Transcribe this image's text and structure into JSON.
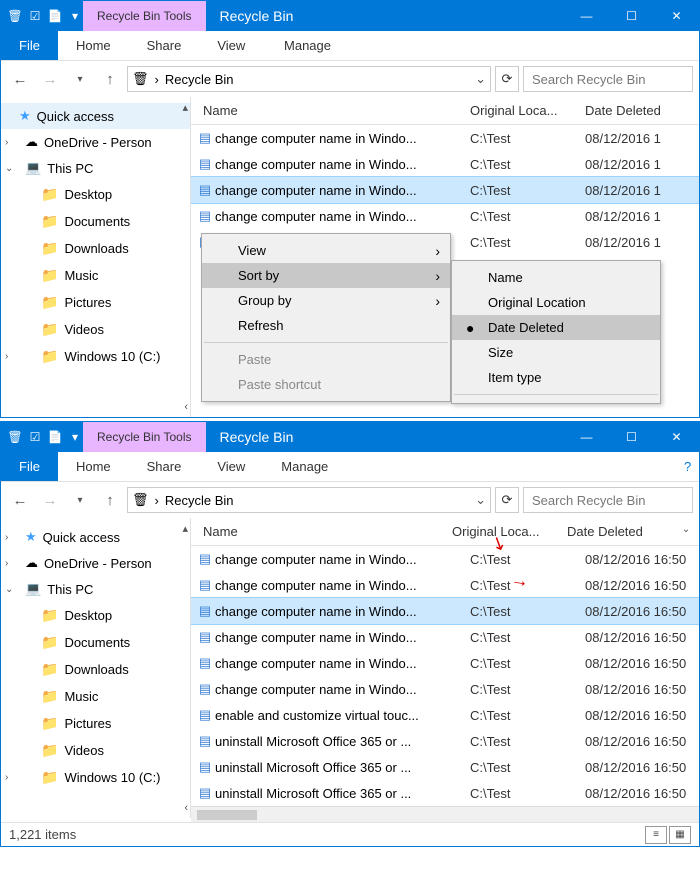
{
  "win1": {
    "tools_tab": "Recycle Bin Tools",
    "title": "Recycle Bin",
    "tabs": {
      "file": "File",
      "home": "Home",
      "share": "Share",
      "view": "View",
      "manage": "Manage"
    },
    "breadcrumb": "Recycle Bin",
    "search_placeholder": "Search Recycle Bin",
    "columns": {
      "name": "Name",
      "loc": "Original Loca...",
      "date": "Date Deleted"
    },
    "sidebar": {
      "quick": "Quick access",
      "onedrive": "OneDrive - Person",
      "thispc": "This PC",
      "items": [
        "Desktop",
        "Documents",
        "Downloads",
        "Music",
        "Pictures",
        "Videos",
        "Windows 10 (C:)"
      ]
    },
    "files": [
      {
        "name": "change computer name in Windo...",
        "loc": "C:\\Test",
        "date": "08/12/2016 1"
      },
      {
        "name": "change computer name in Windo...",
        "loc": "C:\\Test",
        "date": "08/12/2016 1"
      },
      {
        "name": "change computer name in Windo...",
        "loc": "C:\\Test",
        "date": "08/12/2016 1",
        "selected": true
      },
      {
        "name": "change computer name in Windo...",
        "loc": "C:\\Test",
        "date": "08/12/2016 1"
      },
      {
        "name": "",
        "loc": "C:\\Test",
        "date": "08/12/2016 1"
      }
    ],
    "ctx1": {
      "view": "View",
      "sort": "Sort by",
      "group": "Group by",
      "refresh": "Refresh",
      "paste": "Paste",
      "paste_sc": "Paste shortcut"
    },
    "ctx2": {
      "name": "Name",
      "orig": "Original Location",
      "deleted": "Date Deleted",
      "size": "Size",
      "type": "Item type"
    }
  },
  "win2": {
    "tools_tab": "Recycle Bin Tools",
    "title": "Recycle Bin",
    "tabs": {
      "file": "File",
      "home": "Home",
      "share": "Share",
      "view": "View",
      "manage": "Manage"
    },
    "breadcrumb": "Recycle Bin",
    "search_placeholder": "Search Recycle Bin",
    "columns": {
      "name": "Name",
      "loc": "Original Loca...",
      "date": "Date Deleted"
    },
    "sidebar": {
      "quick": "Quick access",
      "onedrive": "OneDrive - Person",
      "thispc": "This PC",
      "items": [
        "Desktop",
        "Documents",
        "Downloads",
        "Music",
        "Pictures",
        "Videos",
        "Windows 10 (C:)"
      ]
    },
    "files": [
      {
        "name": "change computer name in Windo...",
        "loc": "C:\\Test",
        "date": "08/12/2016 16:50"
      },
      {
        "name": "change computer name in Windo...",
        "loc": "C:\\Test",
        "date": "08/12/2016 16:50"
      },
      {
        "name": "change computer name in Windo...",
        "loc": "C:\\Test",
        "date": "08/12/2016 16:50",
        "selected": true
      },
      {
        "name": "change computer name in Windo...",
        "loc": "C:\\Test",
        "date": "08/12/2016 16:50"
      },
      {
        "name": "change computer name in Windo...",
        "loc": "C:\\Test",
        "date": "08/12/2016 16:50"
      },
      {
        "name": "change computer name in Windo...",
        "loc": "C:\\Test",
        "date": "08/12/2016 16:50"
      },
      {
        "name": "enable and customize virtual touc...",
        "loc": "C:\\Test",
        "date": "08/12/2016 16:50"
      },
      {
        "name": "uninstall Microsoft Office 365 or ...",
        "loc": "C:\\Test",
        "date": "08/12/2016 16:50"
      },
      {
        "name": "uninstall Microsoft Office 365 or ...",
        "loc": "C:\\Test",
        "date": "08/12/2016 16:50"
      },
      {
        "name": "uninstall Microsoft Office 365 or ...",
        "loc": "C:\\Test",
        "date": "08/12/2016 16:50"
      }
    ],
    "status": "1,221 items"
  }
}
